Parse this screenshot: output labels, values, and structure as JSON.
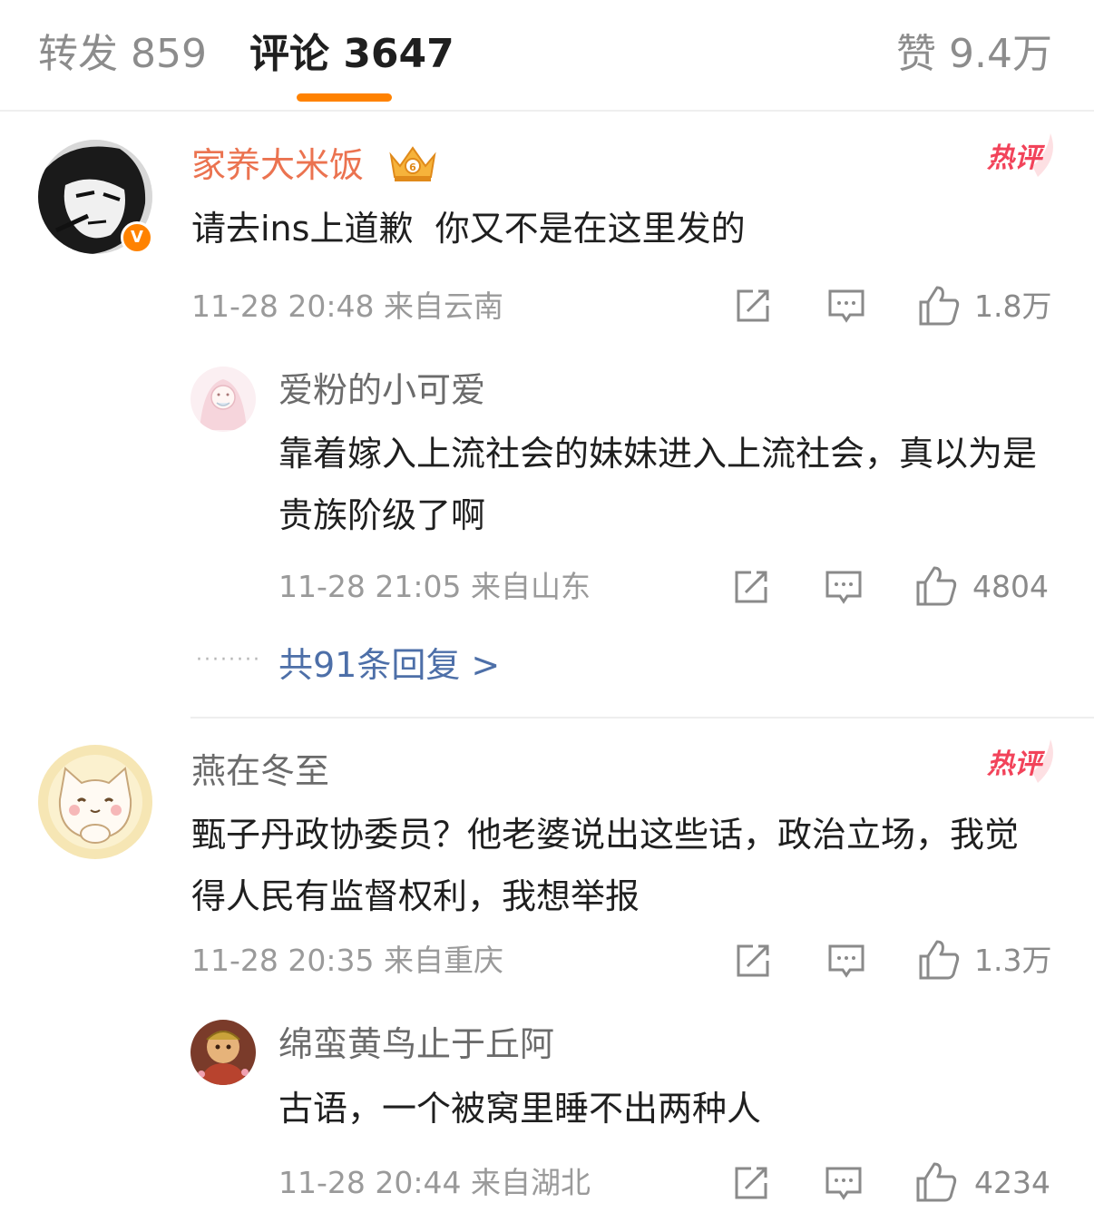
{
  "tabs": {
    "repost": "转发 859",
    "comment": "评论 3647",
    "like": "赞 9.4万"
  },
  "hot_label": "热评",
  "comments": [
    {
      "user": "家养大米饭",
      "text": "请去ins上道歉  你又不是在这里发的",
      "time": "11-28 20:48 来自云南",
      "likes": "1.8万",
      "replies": [
        {
          "user": "爱粉的小可爱",
          "text": "靠着嫁入上流社会的妹妹进入上流社会，真以为是贵族阶级了啊",
          "time": "11-28 21:05 来自山东",
          "likes": "4804"
        }
      ],
      "more_replies": "共91条回复 >"
    },
    {
      "user": "燕在冬至",
      "text": "甄子丹政协委员？他老婆说出这些话，政治立场，我觉得人民有监督权利，我想举报",
      "time": "11-28 20:35 来自重庆",
      "likes": "1.3万",
      "replies": [
        {
          "user": "绵蛮黄鸟止于丘阿",
          "text": "古语，一个被窝里睡不出两种人",
          "time": "11-28 20:44 来自湖北",
          "likes": "4234"
        }
      ]
    }
  ],
  "colors": {
    "accent": "#ff8200",
    "username_vip": "#eb7350",
    "hot": "#f2435a",
    "link": "#4d6fa8"
  },
  "icons": [
    "vip-crown-icon",
    "hot-comment-icon",
    "share-icon",
    "reply-icon",
    "like-icon",
    "verified-badge-icon"
  ]
}
